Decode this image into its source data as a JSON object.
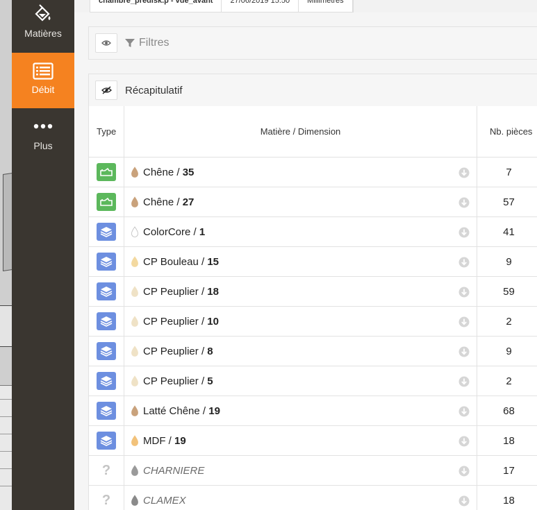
{
  "sidebar": {
    "items": [
      {
        "label": "Matières",
        "icon": "paint-bucket-icon"
      },
      {
        "label": "Débit",
        "icon": "list-icon"
      },
      {
        "label": "Plus",
        "icon": "more-dots-icon"
      }
    ]
  },
  "top_tabs": {
    "file": "chambre_predisk.p - vue_avant",
    "date": "27/06/2019 15:50",
    "unit": "Millimètres"
  },
  "filters": {
    "label": "Filtres"
  },
  "recap": {
    "label": "Récapitulatif"
  },
  "table": {
    "headers": {
      "type": "Type",
      "material": "Matière / Dimension",
      "count": "Nb. pièces"
    },
    "rows": [
      {
        "type": "solid",
        "name": "Chêne",
        "dim": "35",
        "count": "7",
        "drop_color": "#c9a27c"
      },
      {
        "type": "solid",
        "name": "Chêne",
        "dim": "27",
        "count": "57",
        "drop_color": "#c9a27c"
      },
      {
        "type": "panel",
        "name": "ColorCore",
        "dim": "1",
        "count": "41",
        "drop_color": "#ffffff"
      },
      {
        "type": "panel",
        "name": "CP Bouleau",
        "dim": "15",
        "count": "9",
        "drop_color": "#f3d9a0"
      },
      {
        "type": "panel",
        "name": "CP Peuplier",
        "dim": "18",
        "count": "59",
        "drop_color": "#efe2c6"
      },
      {
        "type": "panel",
        "name": "CP Peuplier",
        "dim": "10",
        "count": "2",
        "drop_color": "#efe2c6"
      },
      {
        "type": "panel",
        "name": "CP Peuplier",
        "dim": "8",
        "count": "9",
        "drop_color": "#efe2c6"
      },
      {
        "type": "panel",
        "name": "CP Peuplier",
        "dim": "5",
        "count": "2",
        "drop_color": "#efe2c6"
      },
      {
        "type": "panel",
        "name": "Latté Chêne",
        "dim": "19",
        "count": "68",
        "drop_color": "#c9a27c"
      },
      {
        "type": "panel",
        "name": "MDF",
        "dim": "19",
        "count": "18",
        "drop_color": "#f2c27a"
      },
      {
        "type": "unknown",
        "name": "CHARNIERE",
        "dim": "",
        "count": "17",
        "drop_color": "#9a9a9a"
      },
      {
        "type": "unknown",
        "name": "CLAMEX",
        "dim": "",
        "count": "18",
        "drop_color": "#8a8a8a"
      }
    ]
  },
  "colors": {
    "sidebar_bg": "#3a3630",
    "active_orange": "#f58220",
    "type_green": "#5cb85c",
    "type_blue": "#6d8fe0"
  }
}
